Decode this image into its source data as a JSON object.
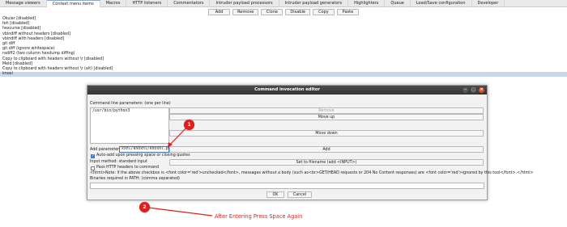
{
  "tabs": [
    {
      "label": "Message viewers",
      "active": false
    },
    {
      "label": "Context menu items",
      "active": true
    },
    {
      "label": "Macros",
      "active": false
    },
    {
      "label": "HTTP listeners",
      "active": false
    },
    {
      "label": "Commentators",
      "active": false
    },
    {
      "label": "Intruder payload processors",
      "active": false
    },
    {
      "label": "Intruder payload generators",
      "active": false
    },
    {
      "label": "Highlighters",
      "active": false
    },
    {
      "label": "Queue",
      "active": false
    },
    {
      "label": "Load/Save configuration",
      "active": false
    },
    {
      "label": "Developer",
      "active": false
    }
  ],
  "toolbar": {
    "add": "Add",
    "remove": "Remove",
    "clone": "Clone",
    "disable": "Disable",
    "copy": "Copy",
    "paste": "Paste"
  },
  "items": [
    {
      "label": "Okular [disabled]",
      "selected": false
    },
    {
      "label": "feh [disabled]",
      "selected": false
    },
    {
      "label": "hexcurse [disabled]",
      "selected": false
    },
    {
      "label": "vbindiff without headers [disabled]",
      "selected": false
    },
    {
      "label": "vbindiff with headers [disabled]",
      "selected": false
    },
    {
      "label": "git diff",
      "selected": false
    },
    {
      "label": "git diff (ignore whitespace)",
      "selected": false
    },
    {
      "label": "radiff2 (two column hexdump diffing)",
      "selected": false
    },
    {
      "label": "Copy to clipboard with headers without \\r [disabled]",
      "selected": false
    },
    {
      "label": "Meld [disabled]",
      "selected": false
    },
    {
      "label": "Copy to clipboard with headers without \\r (alt) [disabled]",
      "selected": false
    },
    {
      "label": "knoxl",
      "selected": true
    }
  ],
  "dialog": {
    "title": "Command invocation editor",
    "params_label": "Command line parameters: (one per line)",
    "params": [
      "/usr/bin/python3"
    ],
    "remove": "Remove",
    "move_up": "Move up",
    "move_down": "Move down",
    "add_param_label": "Add parameter:",
    "add_param_value": "xxnl/knoxnl/knoxnl.py",
    "add": "Add",
    "auto_add_label": "Auto-add upon pressing space or closing quotes",
    "auto_add_checked": true,
    "input_method_label": "Input method: standard input",
    "set_filename": "Set to filename (add <INPUT>)",
    "pass_headers_label": "Pass HTTP headers to command",
    "pass_headers_checked": false,
    "note": "<html>Note: if the above checkbox is <font color='red'>unchecked</font>, messages without a body (such as<br>GET/HEAD requests or 204 No Content responses) are <font color='red'>ignored by this tool</font>.</html>",
    "binaries_label": "Binaries required in PATH: (comma separated)",
    "ok": "OK",
    "cancel": "Cancel"
  },
  "annotations": {
    "marker1": "1",
    "marker2": "2",
    "text2": "After Entering Press Space Again",
    "color": "#e21d1d"
  },
  "colors": {
    "selection": "#c5d8ec",
    "dialog_title_bg": "#3f3f3f",
    "close_button": "#d9532b",
    "annotation": "#e21d1d"
  }
}
